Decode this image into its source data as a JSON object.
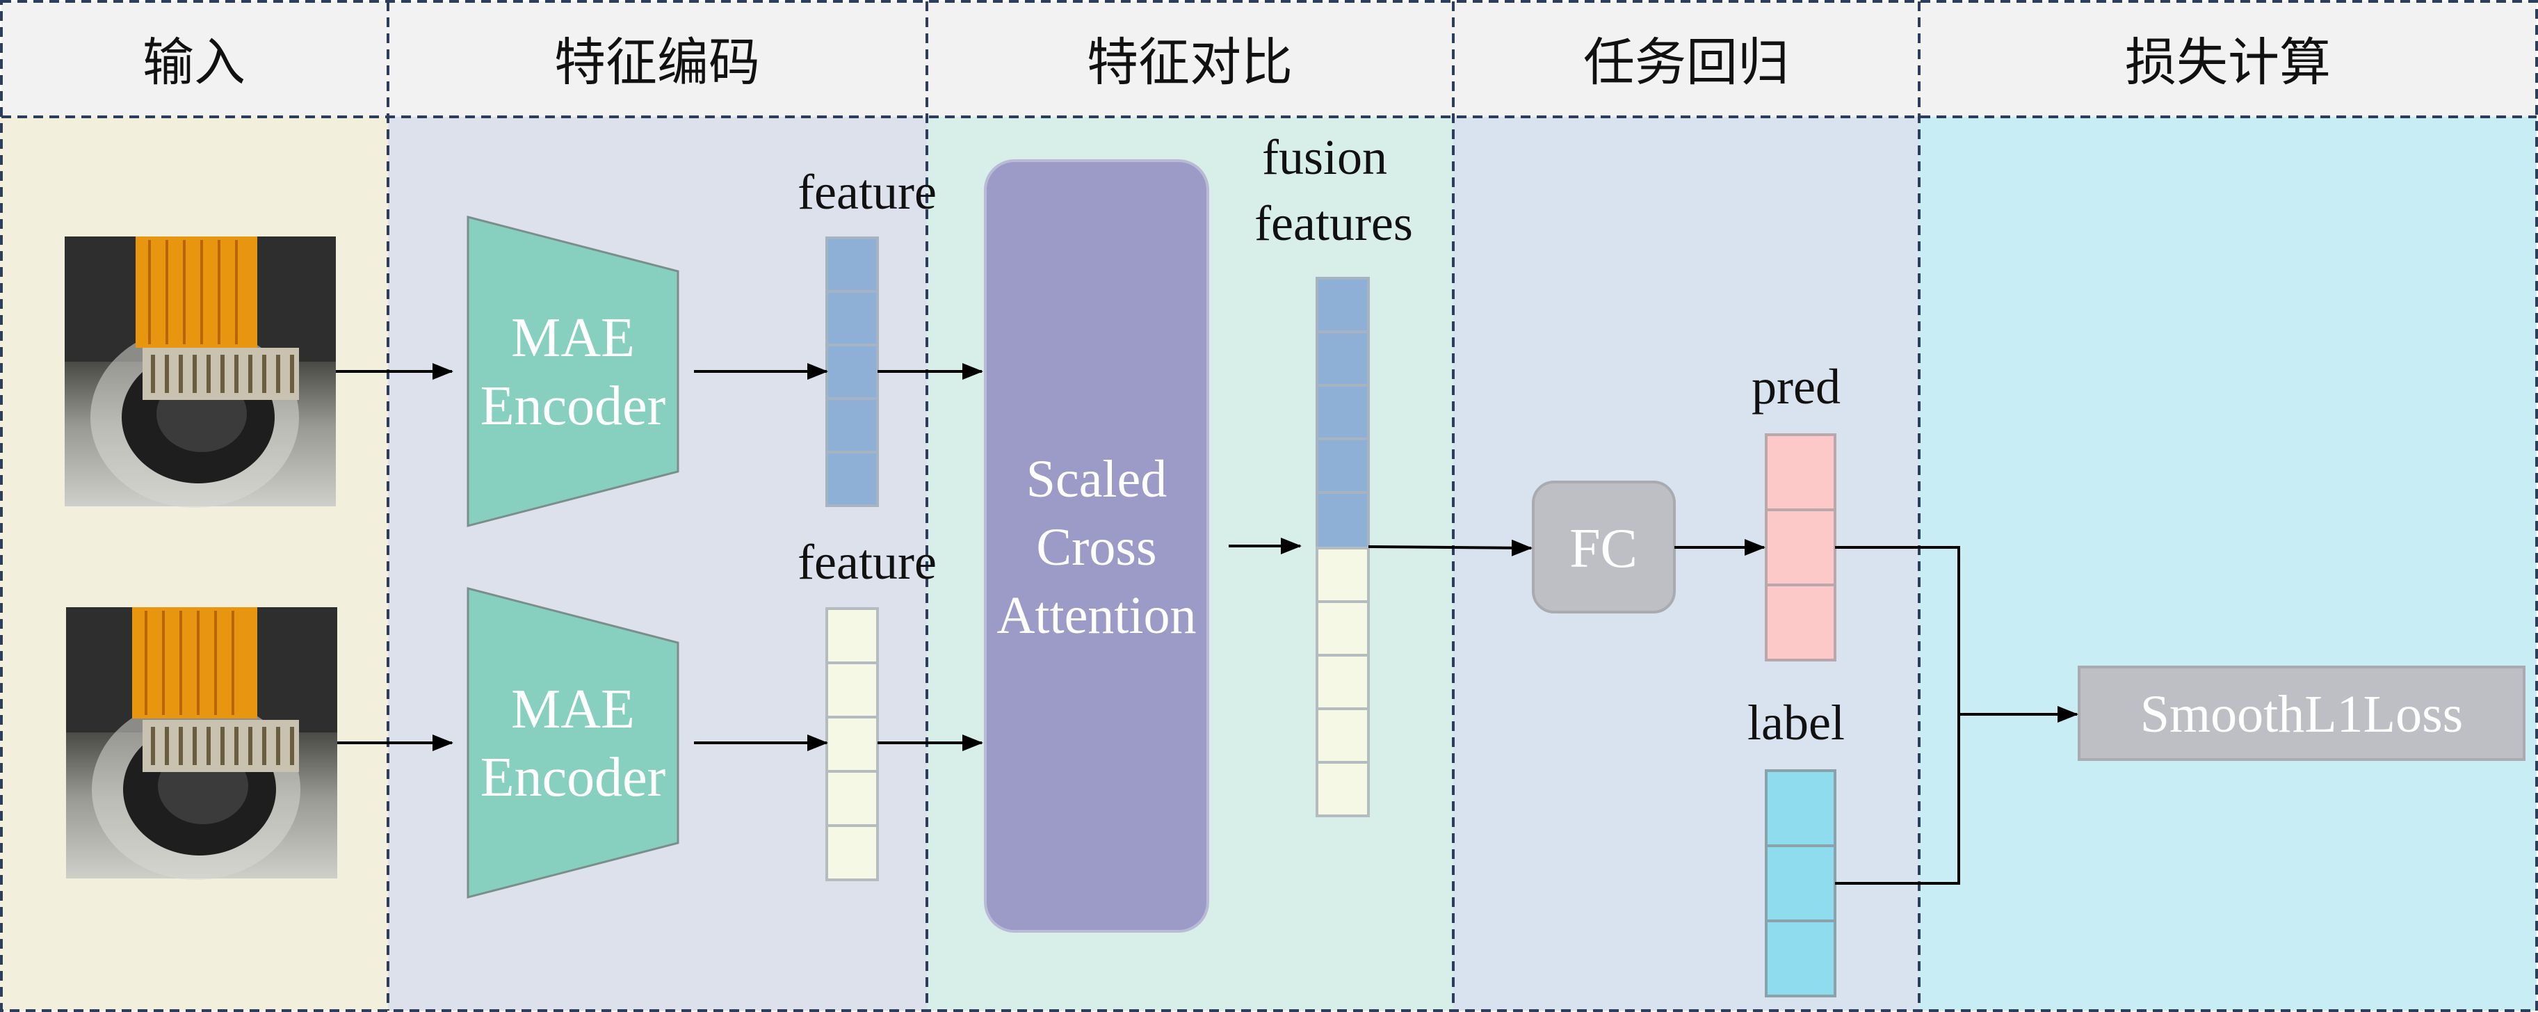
{
  "stages": [
    {
      "title": "输入",
      "color": "#f2efdc"
    },
    {
      "title": "特征编码",
      "color": "#dde1ec"
    },
    {
      "title": "特征对比",
      "color": "#d8efe9"
    },
    {
      "title": "任务回归",
      "color": "#d9e3ef"
    },
    {
      "title": "损失计算",
      "color": "#c8edf4"
    }
  ],
  "encoder": {
    "line1": "MAE",
    "line2": "Encoder"
  },
  "feature_top_label": "feature",
  "feature_bottom_label": "feature",
  "attention": {
    "line1": "Scaled",
    "line2": "Cross",
    "line3": "Attention"
  },
  "fusion_label": {
    "line1": "fusion",
    "line2": "features"
  },
  "fc_label": "FC",
  "pred_label": "pred",
  "label_label": "label",
  "loss_label": "SmoothL1Loss",
  "colors": {
    "header_bg": "#f2f2f2",
    "encoder_fill": "#87d0c0",
    "feature_blue": "#8eafd6",
    "feature_cream": "#f6f8e6",
    "attention_fill": "#9c9bc8",
    "fc_fill": "#bdbfc4",
    "pred_fill": "#fcc8c8",
    "label_fill": "#8fdcee",
    "loss_fill": "#bdbfc4"
  }
}
